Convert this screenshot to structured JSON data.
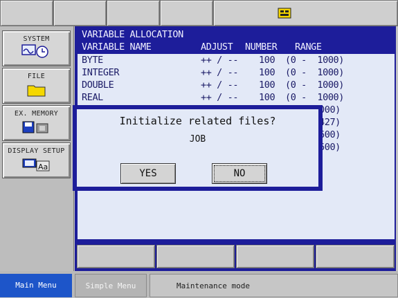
{
  "top_icon": "servo-status-icon",
  "side_menu": [
    {
      "label": "SYSTEM",
      "icon": "system-icon"
    },
    {
      "label": "FILE",
      "icon": "folder-icon"
    },
    {
      "label": "EX. MEMORY",
      "icon": "memory-icon"
    },
    {
      "label": "DISPLAY SETUP",
      "icon": "display-setup-icon"
    }
  ],
  "screen": {
    "title": "VARIABLE ALLOCATION",
    "columns": {
      "name": "VARIABLE NAME",
      "adjust": "ADJUST",
      "number": "NUMBER",
      "range": "RANGE"
    },
    "rows": [
      {
        "name": "BYTE",
        "adjust": "++ / --",
        "number": "100",
        "range": "(0 -  1000)"
      },
      {
        "name": "INTEGER",
        "adjust": "++ / --",
        "number": "100",
        "range": "(0 -  1000)"
      },
      {
        "name": "DOUBLE",
        "adjust": "++ / --",
        "number": "100",
        "range": "(0 -  1000)"
      },
      {
        "name": "REAL",
        "adjust": "++ / --",
        "number": "100",
        "range": "(0 -  1000)"
      }
    ],
    "partial_right": [
      "000)",
      "427)",
      "600)",
      "600)"
    ]
  },
  "dialog": {
    "message": "Initialize related files?",
    "subject": "JOB",
    "yes_label": "YES",
    "no_label": "NO"
  },
  "bottom": {
    "main_menu": "Main Menu",
    "simple_menu": "Simple Menu",
    "status": "Maintenance mode"
  },
  "colors": {
    "frame_blue": "#1d1d9a",
    "main_menu_blue": "#1d55c9",
    "screen_bg": "#e3e9f7"
  }
}
